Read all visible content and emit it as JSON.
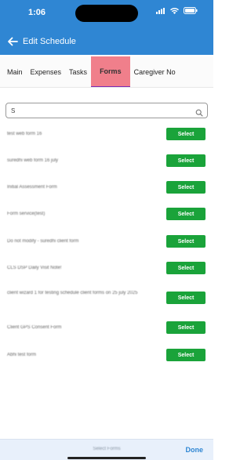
{
  "status_bar": {
    "time": "1:06"
  },
  "header": {
    "title": "Edit Schedule"
  },
  "tabs": [
    {
      "label": "Main"
    },
    {
      "label": "Expenses"
    },
    {
      "label": "Tasks"
    },
    {
      "label": "Forms",
      "active": true
    },
    {
      "label": "Caregiver No"
    }
  ],
  "search": {
    "value": "S"
  },
  "forms": [
    {
      "label": "test web form 16",
      "action": "Select"
    },
    {
      "label": "suredhi web form 16 july",
      "action": "Select"
    },
    {
      "label": "Initial Assessment Form",
      "action": "Select"
    },
    {
      "label": "Form service(test)",
      "action": "Select"
    },
    {
      "label": "Do not modify - suredhi client form",
      "action": "Select"
    },
    {
      "label": "CLS DSP Daily Visit Note!",
      "action": "Select"
    },
    {
      "label": "client wizard 1 for testing schedule client forms on 25 july 2025",
      "action": "Select"
    },
    {
      "label": "Client GPS Consent Form",
      "action": "Select"
    },
    {
      "label": "Abhi test form",
      "action": "Select"
    }
  ],
  "footer": {
    "center_text": "Select Forms",
    "done_label": "Done"
  },
  "colors": {
    "header_bg": "#2f86d3",
    "active_tab_bg": "#f07f8b",
    "active_tab_underline": "#7a2ab3",
    "select_button": "#1aa33a",
    "done_text": "#2f86d3"
  }
}
